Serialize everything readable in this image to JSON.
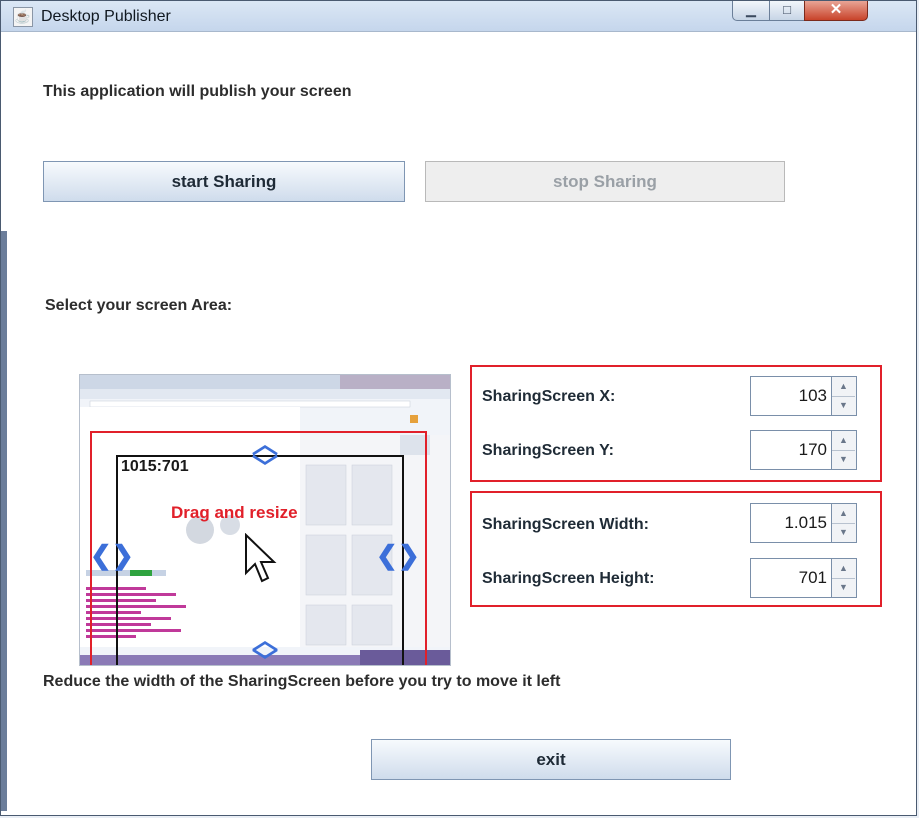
{
  "window": {
    "title": "Desktop Publisher"
  },
  "intro_text": "This application will publish your screen",
  "buttons": {
    "start": "start Sharing",
    "stop": "stop Sharing",
    "exit": "exit"
  },
  "select_area_label": "Select your screen Area:",
  "preview": {
    "size_label": "1015:701",
    "drag_label": "Drag and resize"
  },
  "fields": {
    "x": {
      "label": "SharingScreen X:",
      "value": "103"
    },
    "y": {
      "label": "SharingScreen Y:",
      "value": "170"
    },
    "width": {
      "label": "SharingScreen Width:",
      "value": "1.015"
    },
    "height": {
      "label": "SharingScreen Height:",
      "value": "701"
    }
  },
  "hint_text": "Reduce the width of the SharingScreen before you try to move it left",
  "colors": {
    "accent_red": "#e1202a",
    "arrow_blue": "#3c6fd9",
    "title_bar": "#c5d6ec"
  },
  "icons": [
    "java-app-icon",
    "minimize-icon",
    "maximize-icon",
    "close-icon",
    "spinner-up-icon",
    "spinner-down-icon",
    "arrow-up-icon",
    "arrow-down-icon",
    "arrow-left-icon",
    "arrow-right-icon",
    "mouse-cursor-icon"
  ]
}
